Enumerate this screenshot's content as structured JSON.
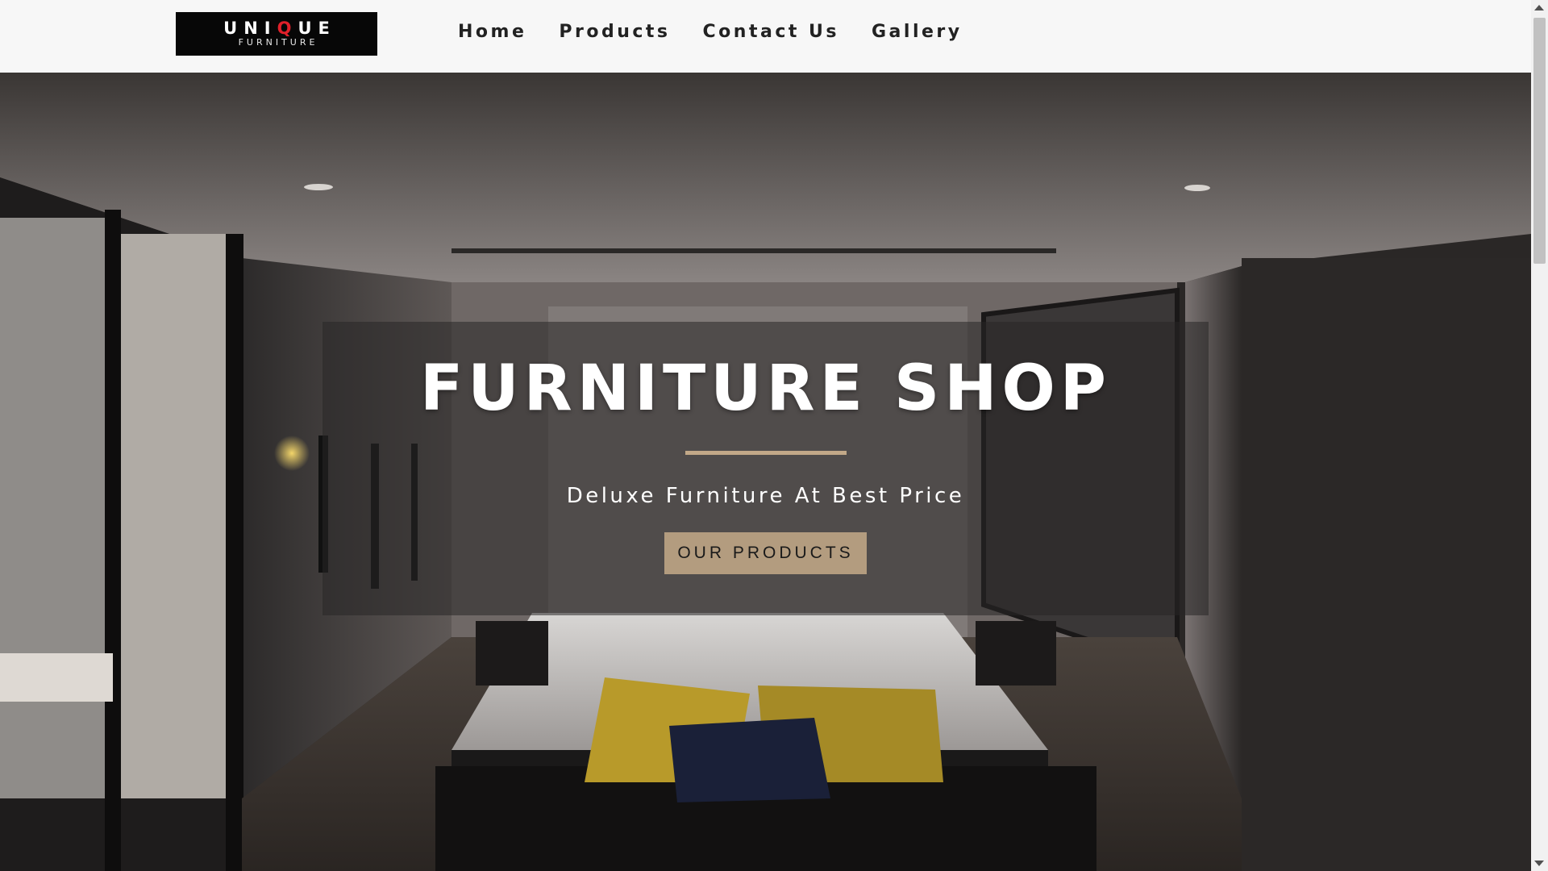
{
  "logo": {
    "top_prefix": "UNI",
    "top_q": "Q",
    "top_suffix": "UE",
    "bottom": "FURNITURE"
  },
  "nav": {
    "items": [
      {
        "label": "Home"
      },
      {
        "label": "Products"
      },
      {
        "label": "Contact Us"
      },
      {
        "label": "Gallery"
      }
    ]
  },
  "hero": {
    "title": "FURNITURE SHOP",
    "subtitle": "Deluxe Furniture At Best Price",
    "button_label": "OUR PRODUCTS"
  },
  "colors": {
    "accent": "#b39c7f",
    "divider": "#c2a888",
    "logo_red": "#e0202a",
    "nav_text": "#222222"
  }
}
